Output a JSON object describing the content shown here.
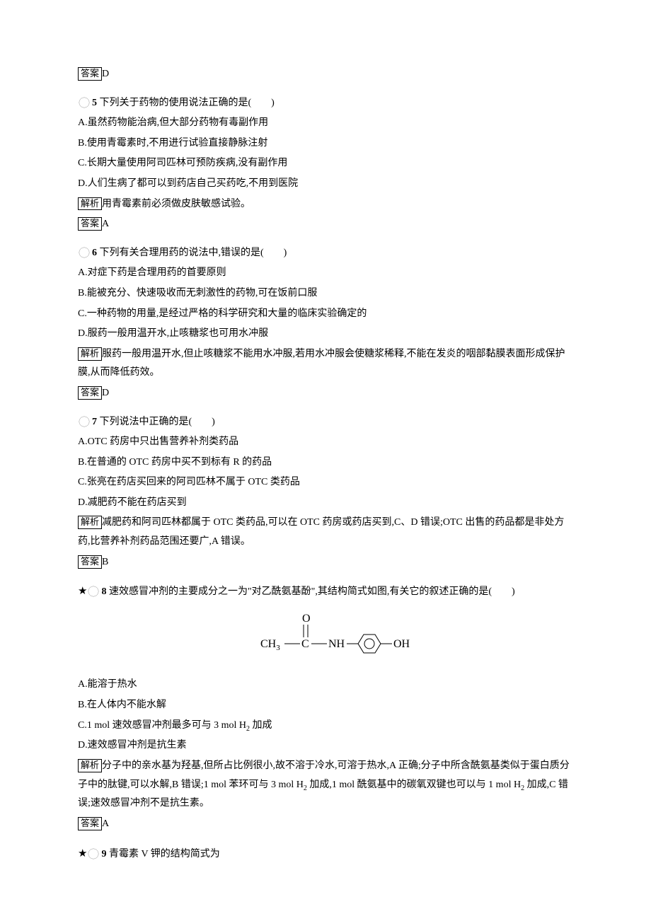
{
  "labels": {
    "answer": "答案",
    "explain": "解析"
  },
  "q4_answer": "D",
  "q5": {
    "num": "5",
    "stem": "下列关于药物的使用说法正确的是(　　)",
    "A": "A.虽然药物能治病,但大部分药物有毒副作用",
    "B": "B.使用青霉素时,不用进行试验直接静脉注射",
    "C": "C.长期大量使用阿司匹林可预防疾病,没有副作用",
    "D": "D.人们生病了都可以到药店自己买药吃,不用到医院",
    "explain": "用青霉素前必须做皮肤敏感试验。",
    "answer": "A"
  },
  "q6": {
    "num": "6",
    "stem": "下列有关合理用药的说法中,错误的是(　　)",
    "A": "A.对症下药是合理用药的首要原则",
    "B": "B.能被充分、快速吸收而无刺激性的药物,可在饭前口服",
    "C": "C.一种药物的用量,是经过严格的科学研究和大量的临床实验确定的",
    "D": "D.服药一般用温开水,止咳糖浆也可用水冲服",
    "explain": "服药一般用温开水,但止咳糖浆不能用水冲服,若用水冲服会使糖浆稀释,不能在发炎的咽部黏膜表面形成保护膜,从而降低药效。",
    "answer": "D"
  },
  "q7": {
    "num": "7",
    "stem": "下列说法中正确的是(　　)",
    "A": "A.OTC 药房中只出售营养补剂类药品",
    "B": "B.在普通的 OTC 药房中买不到标有 R 的药品",
    "C": "C.张亮在药店买回来的阿司匹林不属于 OTC 类药品",
    "D": "D.减肥药不能在药店买到",
    "explain": "减肥药和阿司匹林都属于 OTC 类药品,可以在 OTC 药房或药店买到,C、D 错误;OTC 出售的药品都是非处方药,比营养补剂药品范围还要广,A 错误。",
    "answer": "B"
  },
  "q8": {
    "num": "8",
    "stem": "速效感冒冲剂的主要成分之一为\"对乙酰氨基酚\",其结构简式如图,有关它的叙述正确的是(　　)",
    "formula_left": "CH",
    "formula_sub3": "3",
    "formula_c": "C",
    "formula_o": "O",
    "formula_nh": "NH",
    "formula_oh": "OH",
    "A": "A.能溶于热水",
    "B": "B.在人体内不能水解",
    "C_pre": "C.1 mol 速效感冒冲剂最多可与 3 mol H",
    "C_sub": "2",
    "C_post": " 加成",
    "D": "D.速效感冒冲剂是抗生素",
    "explain_pre": "分子中的亲水基为羟基,但所占比例很小,故不溶于冷水,可溶于热水,A 正确;分子中所含酰氨基类似于蛋白质分子中的肽键,可以水解,B 错误;1 mol 苯环可与 3 mol H",
    "explain_sub1": "2",
    "explain_mid": " 加成,1 mol 酰氨基中的碳氧双键也可以与 1 mol H",
    "explain_sub2": "2",
    "explain_post": " 加成,C 错误;速效感冒冲剂不是抗生素。",
    "answer": "A"
  },
  "q9": {
    "num": "9",
    "stem": "青霉素 V 钾的结构简式为"
  }
}
